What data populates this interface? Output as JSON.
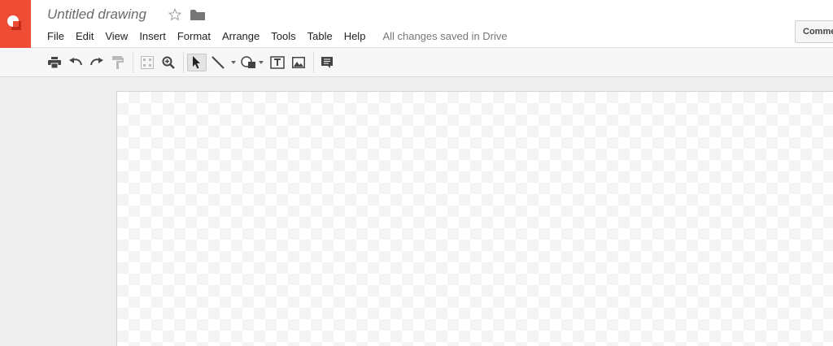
{
  "app": {
    "brand_color": "#ef4c36"
  },
  "document": {
    "title": "Untitled drawing"
  },
  "header_icons": {
    "star": "star-outline-icon",
    "folder": "folder-icon"
  },
  "menu": {
    "items": [
      "File",
      "Edit",
      "View",
      "Insert",
      "Format",
      "Arrange",
      "Tools",
      "Table",
      "Help"
    ],
    "save_status": "All changes saved in Drive"
  },
  "comments_button": {
    "label": "Comments"
  },
  "toolbar": {
    "tools": [
      "print-icon",
      "undo-icon",
      "redo-icon",
      "paint-format-icon",
      "snap-to-grid-icon",
      "zoom-icon",
      "select-cursor-icon",
      "line-icon",
      "shape-icon",
      "textbox-icon",
      "image-icon",
      "comment-icon"
    ],
    "active_tool": "select-cursor-icon"
  }
}
